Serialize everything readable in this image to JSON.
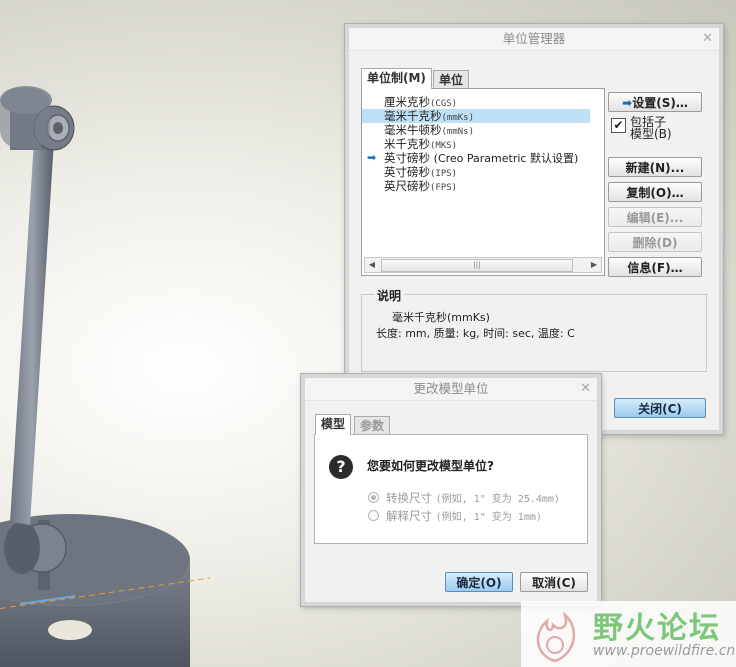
{
  "units_manager": {
    "title": "单位管理器",
    "tabs": [
      "单位制(M)",
      "单位"
    ],
    "systems": [
      {
        "name": "厘米克秒",
        "code": "(CGS)"
      },
      {
        "name": "毫米千克秒",
        "code": "(mmKs)"
      },
      {
        "name": "毫米牛顿秒",
        "code": "(mmNs)"
      },
      {
        "name": "米千克秒",
        "code": "(MKS)"
      },
      {
        "name": "英寸磅秒",
        "code": "(Creo Parametric 默认设置)"
      },
      {
        "name": "英寸磅秒",
        "code": "(IPS)"
      },
      {
        "name": "英尺磅秒",
        "code": "(FPS)"
      }
    ],
    "selected_index": 1,
    "current_index": 4,
    "buttons": {
      "set": "设置(S)…",
      "include_submodels_line1": "包括子",
      "include_submodels_line2": "模型(B)",
      "new": "新建(N)...",
      "copy": "复制(O)…",
      "edit": "编辑(E)...",
      "delete": "删除(D)",
      "info": "信息(F)…",
      "close": "关闭(C)"
    },
    "description": {
      "label": "说明",
      "name": "毫米千克秒(mmKs)",
      "detail": "长度: mm, 质量: kg, 时间: sec, 温度: C"
    }
  },
  "change_units": {
    "title": "更改模型单位",
    "tabs": [
      "模型",
      "参数"
    ],
    "question": "您要如何更改模型单位?",
    "options": [
      {
        "label": "转换尺寸",
        "example": "(例如, 1\" 变为 25.4mm)",
        "selected": true
      },
      {
        "label": "解释尺寸",
        "example": "(例如, 1\" 变为 1mm)",
        "selected": false
      }
    ],
    "ok": "确定(O)",
    "cancel": "取消(C)"
  },
  "watermark": {
    "text": "野火论坛",
    "url": "www.proewildfire.cn"
  }
}
